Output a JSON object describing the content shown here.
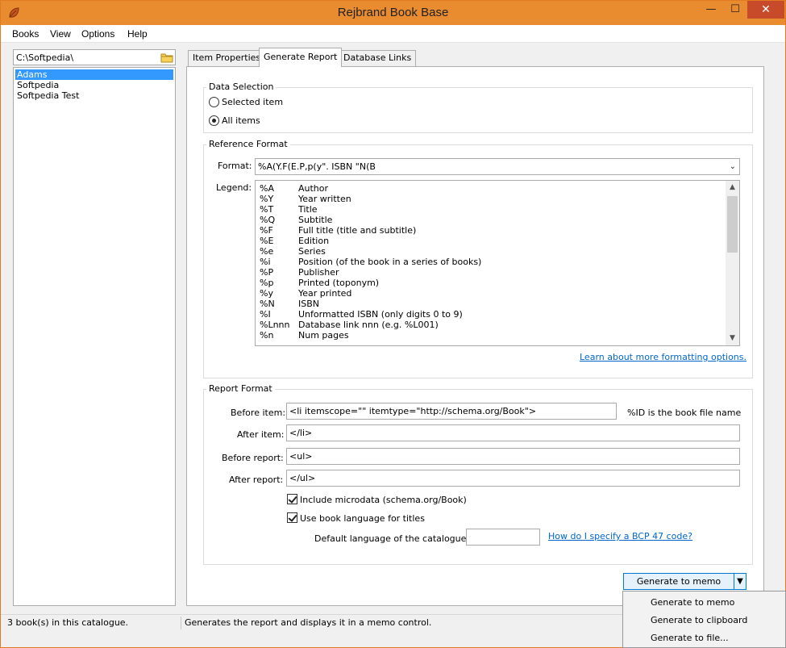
{
  "window": {
    "title": "Rejbrand Book Base",
    "minimize_glyph": "—",
    "maximize_glyph": "☐",
    "close_glyph": "✕"
  },
  "menu": [
    "Books",
    "View",
    "Options",
    "Help"
  ],
  "left_panel": {
    "path": "C:\\Softpedia\\",
    "books": [
      "Adams",
      "Softpedia",
      "Softpedia Test"
    ],
    "selected_index": 0
  },
  "tabs": [
    {
      "label": "Item Properties",
      "active": false
    },
    {
      "label": "Generate Report",
      "active": true
    },
    {
      "label": "Database Links",
      "active": false
    }
  ],
  "data_selection": {
    "title": "Data Selection",
    "options": [
      "Selected item",
      "All items"
    ],
    "selected": "All items"
  },
  "reference_format": {
    "title": "Reference Format",
    "format_label": "Format:",
    "format_value": "%A(Y.F(E.P,p(y\". ISBN \"N(B",
    "legend_label": "Legend:",
    "legend": [
      {
        "code": "%A",
        "desc": "Author"
      },
      {
        "code": "%Y",
        "desc": "Year written"
      },
      {
        "code": "%T",
        "desc": "Title"
      },
      {
        "code": "%Q",
        "desc": "Subtitle"
      },
      {
        "code": "%F",
        "desc": "Full title (title and subtitle)"
      },
      {
        "code": "%E",
        "desc": "Edition"
      },
      {
        "code": "%e",
        "desc": "Series"
      },
      {
        "code": "%i",
        "desc": "Position (of the book in a series of books)"
      },
      {
        "code": "%P",
        "desc": "Publisher"
      },
      {
        "code": "%p",
        "desc": "Printed (toponym)"
      },
      {
        "code": "%y",
        "desc": "Year printed"
      },
      {
        "code": "%N",
        "desc": "ISBN"
      },
      {
        "code": "%I",
        "desc": "Unformatted ISBN (only digits 0 to 9)"
      },
      {
        "code": "%Lnnn",
        "desc": "Database link nnn (e.g. %L001)"
      },
      {
        "code": "%n",
        "desc": "Num pages"
      }
    ],
    "more_link": "Learn about more formatting options."
  },
  "report_format": {
    "title": "Report Format",
    "before_item_label": "Before item:",
    "before_item_value": "<li itemscope=\"\" itemtype=\"http://schema.org/Book\">",
    "id_note": "%ID is the book file name",
    "after_item_label": "After item:",
    "after_item_value": "</li>",
    "before_report_label": "Before report:",
    "before_report_value": "<ul>",
    "after_report_label": "After report:",
    "after_report_value": "</ul>",
    "include_microdata": "Include microdata (schema.org/Book)",
    "use_book_language": "Use book language for titles",
    "default_language_label": "Default language of the catalogue:",
    "default_language_value": "",
    "bcp47_link": "How do I specify a BCP 47 code?"
  },
  "generate": {
    "button_label": "Generate to memo",
    "menu": [
      "Generate to memo",
      "Generate to clipboard",
      "Generate to file..."
    ]
  },
  "status": {
    "left": "3 book(s) in this catalogue.",
    "right": "Generates the report and displays it in a memo control."
  }
}
